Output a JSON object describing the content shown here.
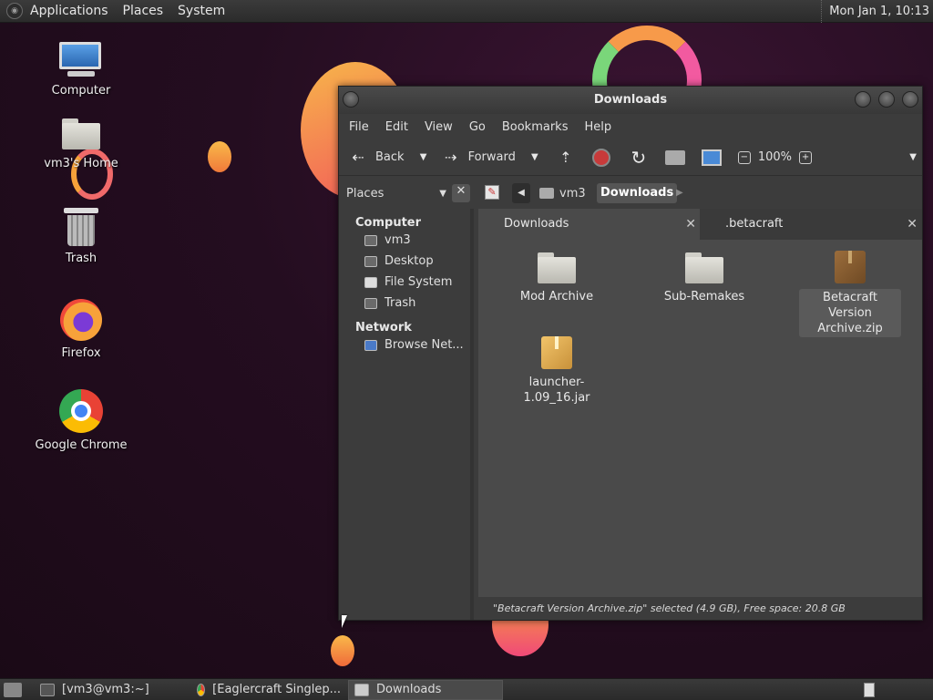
{
  "topbar": {
    "menus": [
      "Applications",
      "Places",
      "System"
    ],
    "clock": "Mon Jan  1, 10:13"
  },
  "desktop": {
    "icons": [
      {
        "label": "Computer"
      },
      {
        "label": "vm3's Home"
      },
      {
        "label": "Trash"
      },
      {
        "label": "Firefox"
      },
      {
        "label": "Google Chrome"
      }
    ]
  },
  "window": {
    "title": "Downloads",
    "menu": [
      "File",
      "Edit",
      "View",
      "Go",
      "Bookmarks",
      "Help"
    ],
    "toolbar": {
      "back": "Back",
      "forward": "Forward",
      "zoom": "100%"
    },
    "places_selector": "Places",
    "path": [
      "vm3",
      "Downloads"
    ],
    "sidebar": {
      "computer_heading": "Computer",
      "computer_items": [
        "vm3",
        "Desktop",
        "File System",
        "Trash"
      ],
      "network_heading": "Network",
      "network_items": [
        "Browse Net..."
      ]
    },
    "tabs": [
      "Downloads",
      ".betacraft"
    ],
    "files": [
      {
        "name": "Mod Archive",
        "type": "folder"
      },
      {
        "name": "Sub-Remakes",
        "type": "folder"
      },
      {
        "name": "Betacraft Version Archive.zip",
        "type": "archive",
        "selected": true
      },
      {
        "name": "launcher-1.09_16.jar",
        "type": "jar"
      }
    ],
    "status": "\"Betacraft Version Archive.zip\" selected (4.9 GB), Free space: 20.8 GB"
  },
  "taskbar": {
    "tasks": [
      "[vm3@vm3:~]",
      "[Eaglercraft Singlep...",
      "Downloads"
    ]
  },
  "colors": {
    "accent_orange": "#f7a23a",
    "accent_pink": "#f04a78"
  }
}
